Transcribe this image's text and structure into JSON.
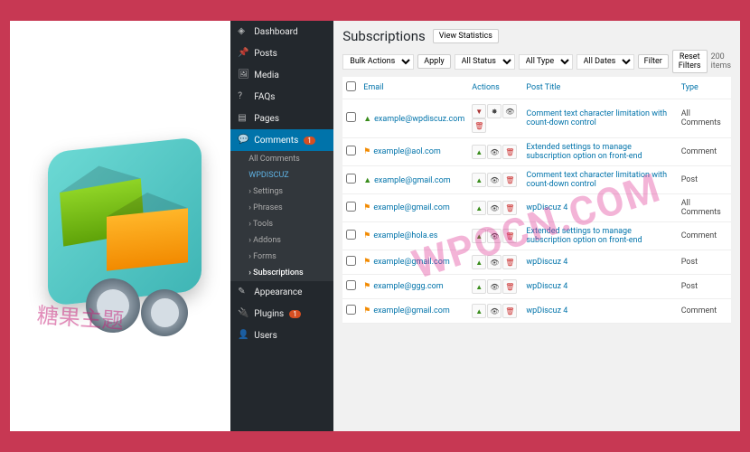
{
  "watermark": "WPOCN.COM",
  "watermark2": "糖果主题",
  "sidebar": {
    "items": [
      {
        "label": "Dashboard",
        "icon": "◈"
      },
      {
        "label": "Posts",
        "icon": "📌"
      },
      {
        "label": "Media",
        "icon": "🖼"
      },
      {
        "label": "FAQs",
        "icon": "?"
      },
      {
        "label": "Pages",
        "icon": "▤"
      },
      {
        "label": "Comments",
        "icon": "💬",
        "badge": "1",
        "active": true
      },
      {
        "label": "Appearance",
        "icon": "✎"
      },
      {
        "label": "Plugins",
        "icon": "🔌",
        "badge": "1"
      },
      {
        "label": "Users",
        "icon": "👤"
      }
    ],
    "subs": [
      {
        "label": "All Comments"
      },
      {
        "label": "WPDISCUZ",
        "hl": true
      },
      {
        "label": "› Settings"
      },
      {
        "label": "› Phrases"
      },
      {
        "label": "› Tools"
      },
      {
        "label": "› Addons"
      },
      {
        "label": "› Forms"
      },
      {
        "label": "› Subscriptions",
        "cur": true
      }
    ]
  },
  "page": {
    "title": "Subscriptions",
    "viewStats": "View Statistics"
  },
  "filters": {
    "bulk": "Bulk Actions",
    "apply": "Apply",
    "status": "All Status",
    "type": "All Type",
    "dates": "All Dates",
    "filter": "Filter",
    "reset": "Reset Filters",
    "count": "200 items"
  },
  "columns": {
    "email": "Email",
    "actions": "Actions",
    "post": "Post Title",
    "type": "Type"
  },
  "rows": [
    {
      "icon": "up",
      "email": "example@wpdiscuz.com",
      "actions4": true,
      "post": "Comment text character limitation with count-down control",
      "type": "All Comments"
    },
    {
      "icon": "flag",
      "email": "example@aol.com",
      "post": "Extended settings to manage subscription option on front-end",
      "type": "Comment"
    },
    {
      "icon": "up",
      "email": "example@gmail.com",
      "post": "Comment text character limitation with count-down control",
      "type": "Post"
    },
    {
      "icon": "flag",
      "email": "example@gmail.com",
      "post": "wpDiscuz 4",
      "type": "All Comments"
    },
    {
      "icon": "flag",
      "email": "example@hola.es",
      "post": "Extended settings to manage subscription option on front-end",
      "type": "Comment"
    },
    {
      "icon": "flag",
      "email": "example@gmail.com",
      "post": "wpDiscuz 4",
      "type": "Post"
    },
    {
      "icon": "flag",
      "email": "example@ggg.com",
      "post": "wpDiscuz 4",
      "type": "Post"
    },
    {
      "icon": "flag",
      "email": "example@gmail.com",
      "post": "wpDiscuz 4",
      "type": "Comment"
    }
  ]
}
